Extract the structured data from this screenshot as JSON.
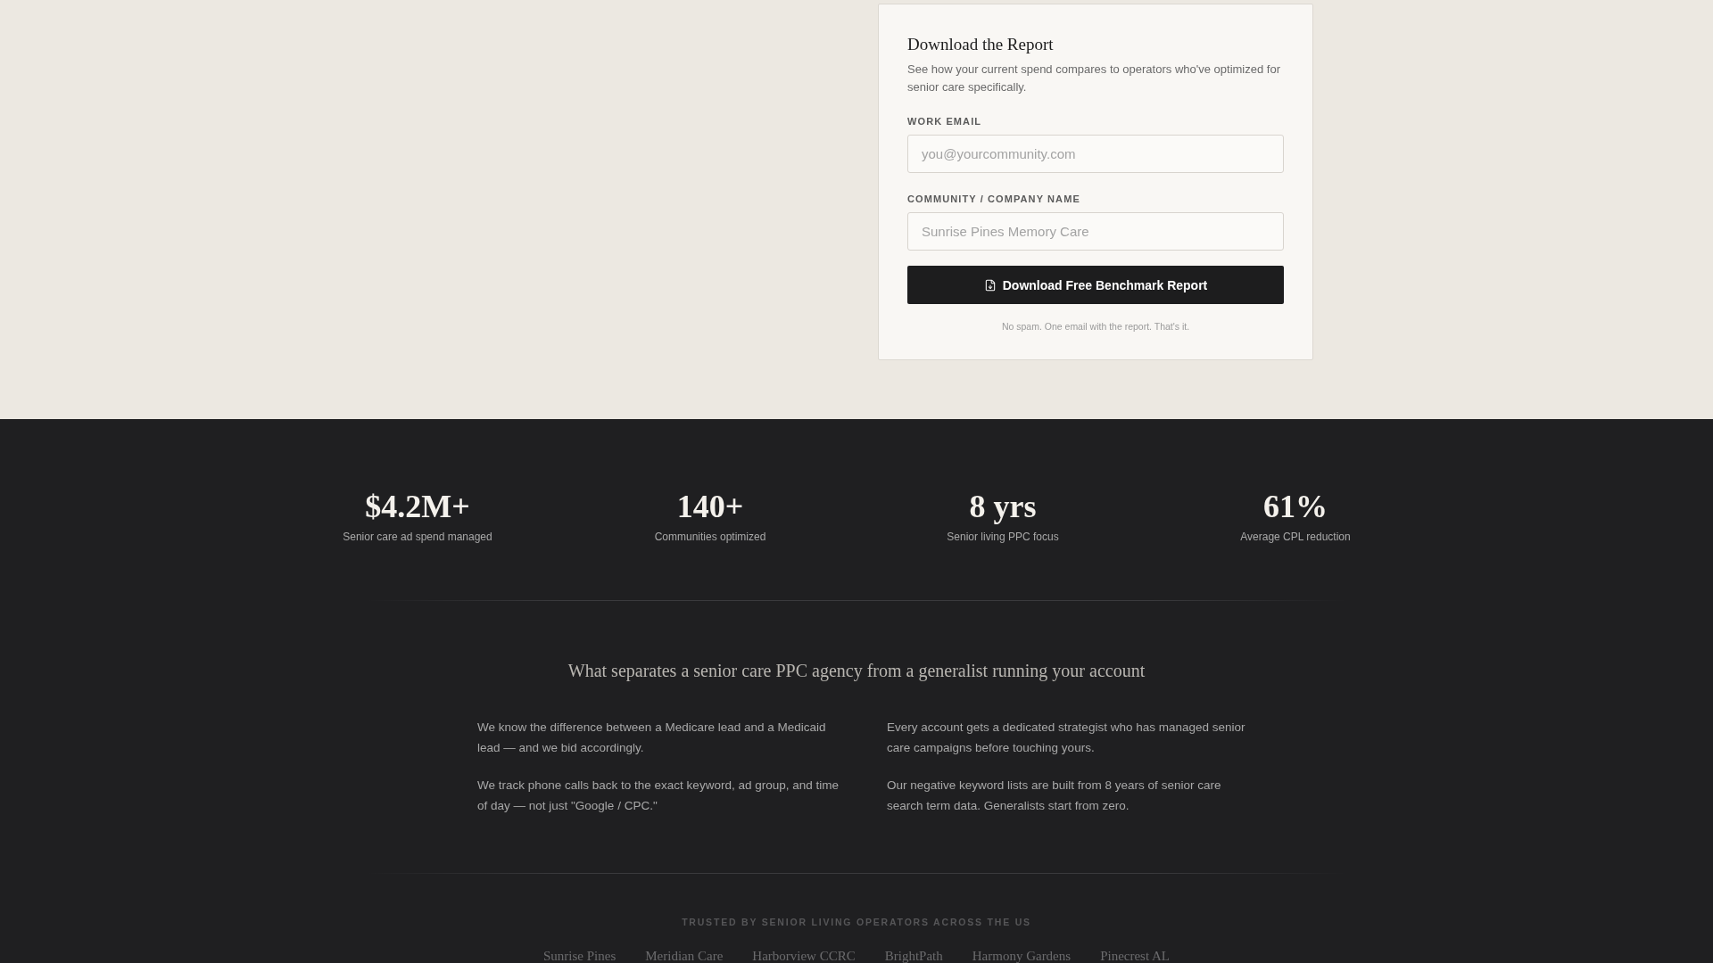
{
  "report_form": {
    "title": "Download the Report",
    "description": "See how your current spend compares to operators who've optimized for senior care specifically.",
    "fields": [
      {
        "label": "WORK EMAIL",
        "placeholder": "you@yourcommunity.com"
      },
      {
        "label": "COMMUNITY / COMPANY NAME",
        "placeholder": "Sunrise Pines Memory Care"
      }
    ],
    "button": "Download Free Benchmark Report",
    "note": "No spam. One email with the report. That's it."
  },
  "stats": [
    {
      "value": "$4.2M+",
      "label": "Senior care ad spend managed"
    },
    {
      "value": "140+",
      "label": "Communities optimized"
    },
    {
      "value": "8 yrs",
      "label": "Senior living PPC focus"
    },
    {
      "value": "61%",
      "label": "Average CPL reduction"
    }
  ],
  "comparison": {
    "heading": "What separates a senior care PPC agency from a generalist running your account",
    "points": [
      "We know the difference between a Medicare lead and a Medicaid lead — and we bid accordingly.",
      "Every account gets a dedicated strategist who has managed senior care campaigns before touching yours.",
      "We track phone calls back to the exact keyword, ad group, and time of day — not just \"Google / CPC.\"",
      "Our negative keyword lists are built from 8 years of senior care search term data. Generalists start from zero."
    ]
  },
  "trusted": {
    "label": "TRUSTED BY SENIOR LIVING OPERATORS ACROSS THE US",
    "logos": [
      "Sunrise Pines",
      "Meridian Care",
      "Harborview CCRC",
      "BrightPath",
      "Harmony Gardens",
      "Pinecrest AL"
    ]
  }
}
